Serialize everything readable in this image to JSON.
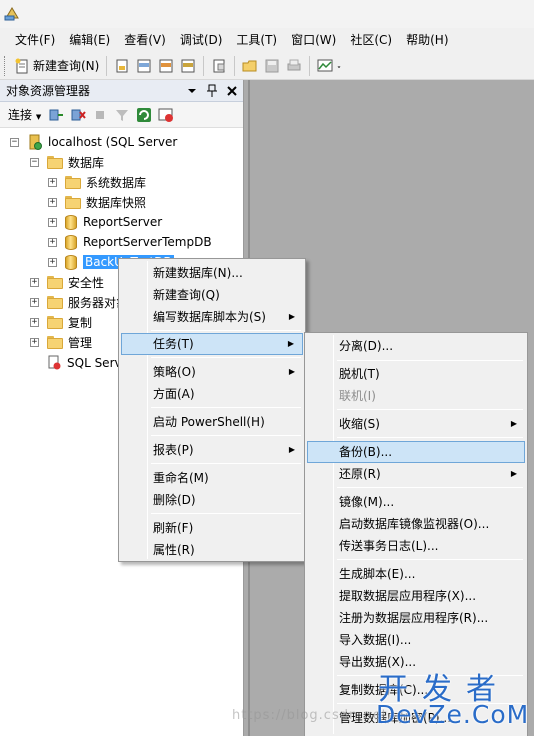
{
  "menubar": {
    "items": [
      "文件(F)",
      "编辑(E)",
      "查看(V)",
      "调试(D)",
      "工具(T)",
      "窗口(W)",
      "社区(C)",
      "帮助(H)"
    ]
  },
  "toolbar": {
    "new_query_label": "新建查询(N)"
  },
  "explorer": {
    "title": "对象资源管理器",
    "connect_label": "连接"
  },
  "tree": {
    "server": "localhost (SQL Server",
    "databases": "数据库",
    "system_databases": "系统数据库",
    "snapshots": "数据库快照",
    "report_server": "ReportServer",
    "report_server_temp": "ReportServerTempDB",
    "selected_db": "BackUpTestDB",
    "security": "安全性",
    "server_objects": "服务器对象",
    "replication": "复制",
    "management": "管理",
    "agent": "SQL Server 代理"
  },
  "context_menu": {
    "new_database": "新建数据库(N)...",
    "new_query": "新建查询(Q)",
    "script_as": "编写数据库脚本为(S)",
    "tasks": "任务(T)",
    "policies": "策略(O)",
    "facets": "方面(A)",
    "powershell": "启动 PowerShell(H)",
    "reports": "报表(P)",
    "rename": "重命名(M)",
    "delete": "删除(D)",
    "refresh": "刷新(F)",
    "properties": "属性(R)"
  },
  "tasks_menu": {
    "detach": "分离(D)...",
    "take_offline": "脱机(T)",
    "bring_online": "联机(I)",
    "shrink": "收缩(S)",
    "backup": "备份(B)...",
    "restore": "还原(R)",
    "mirror": "镜像(M)...",
    "mirror_monitor": "启动数据库镜像监视器(O)...",
    "log_shipping": "传送事务日志(L)...",
    "generate_scripts": "生成脚本(E)...",
    "extract_dac": "提取数据层应用程序(X)...",
    "register_dac": "注册为数据层应用程序(R)...",
    "import_data": "导入数据(I)...",
    "export_data": "导出数据(X)...",
    "copy_database": "复制数据库(C)...",
    "manage_encryption": "管理数据库加密(P)..."
  },
  "watermark": {
    "url": "https://blog.csdn.net",
    "logo_cn": "开发者",
    "logo_en": "DevZe.CoM"
  }
}
